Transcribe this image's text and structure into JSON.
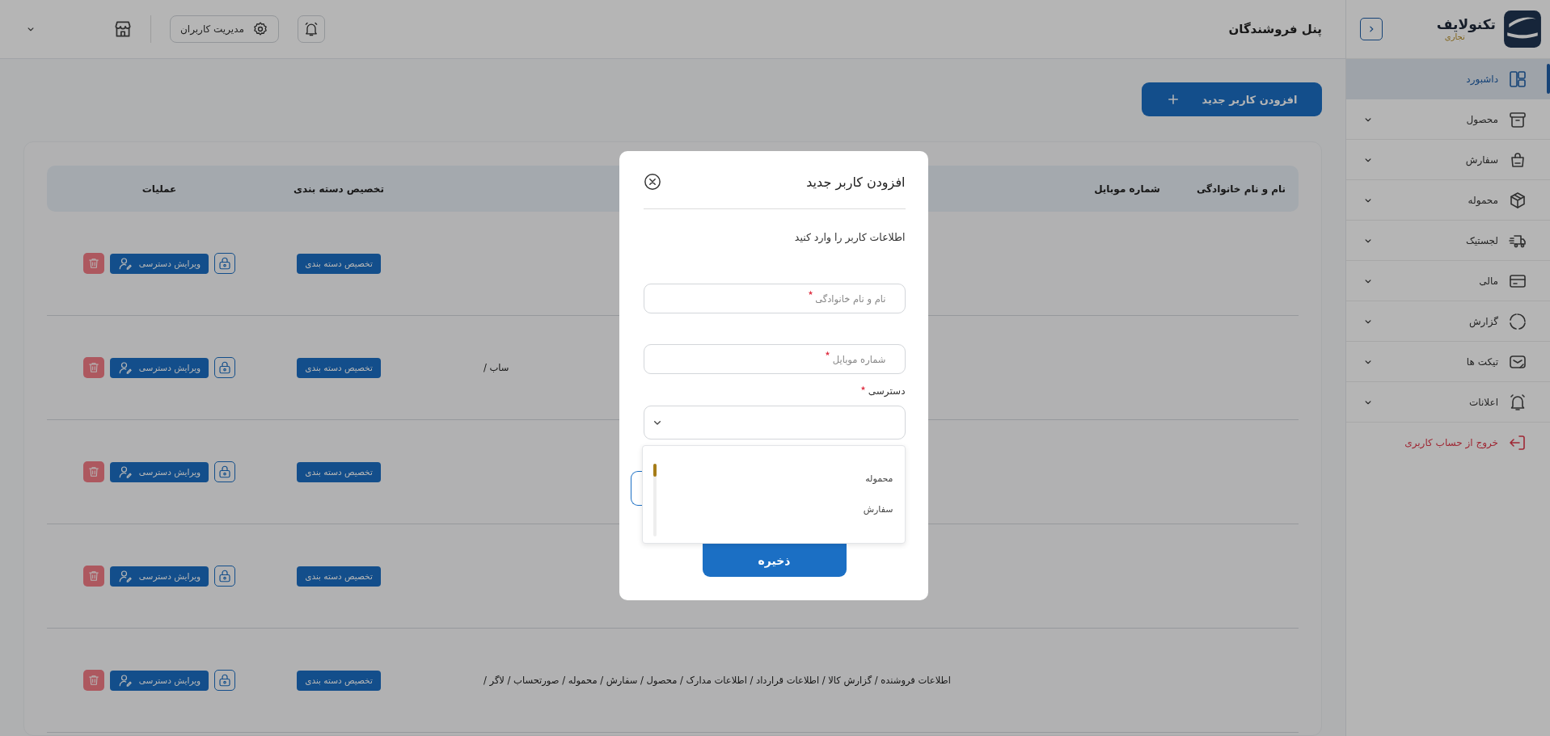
{
  "sidebar": {
    "brand": {
      "name": "تکنولایف",
      "tagline": "تجاری"
    },
    "items": [
      {
        "label": "داشبورد",
        "kind": "dashboard",
        "selected": true,
        "expandable": false
      },
      {
        "label": "محصول",
        "kind": "archive",
        "selected": false,
        "expandable": true
      },
      {
        "label": "سفارش",
        "kind": "bag",
        "selected": false,
        "expandable": true
      },
      {
        "label": "محموله",
        "kind": "package",
        "selected": false,
        "expandable": true
      },
      {
        "label": "لجستیک",
        "kind": "truck",
        "selected": false,
        "expandable": true
      },
      {
        "label": "مالی",
        "kind": "card",
        "selected": false,
        "expandable": true
      },
      {
        "label": "گزارش",
        "kind": "circle",
        "selected": false,
        "expandable": true
      },
      {
        "label": "تیکت ها",
        "kind": "ticket",
        "selected": false,
        "expandable": true
      },
      {
        "label": "اعلانات",
        "kind": "bell",
        "selected": false,
        "expandable": true
      }
    ],
    "logout": "خروج از حساب کاربری"
  },
  "topbar": {
    "title": "پنل فروشندگان",
    "user_management": "مدیریت کاربران"
  },
  "add_button": "افزودن کاربر جدید",
  "table": {
    "columns": [
      "نام و نام خانوادگی",
      "شماره موبایل",
      "تخصیص دسته بندی",
      "عملیات"
    ],
    "rows": [
      {
        "access": "",
        "assign": "تخصیص دسته بندی",
        "edit": "ویرایش دسترسی"
      },
      {
        "access": "ساب /",
        "assign": "تخصیص دسته بندی",
        "edit": "ویرایش دسترسی"
      },
      {
        "access": "",
        "assign": "تخصیص دسته بندی",
        "edit": "ویرایش دسترسی"
      },
      {
        "access": "",
        "assign": "تخصیص دسته بندی",
        "edit": "ویرایش دسترسی"
      },
      {
        "access": "اطلاعات فروشنده / گزارش کالا / اطلاعات قرارداد / اطلاعات مدارک / محصول / سفارش / محموله / صورتحساب / لاگر /",
        "assign": "تخصیص دسته بندی",
        "edit": "ویرایش دسترسی"
      }
    ]
  },
  "modal": {
    "title": "افزودن کاربر جدید",
    "subtitle": "اطلاعات کاربر را وارد کنید",
    "fields": [
      {
        "placeholder": "نام و نام خانوادگی",
        "required": true
      },
      {
        "placeholder": "شماره موبایل",
        "required": true
      }
    ],
    "access": {
      "label": "دسترسی",
      "required": true,
      "options": [
        {
          "label": "محموله",
          "selected": false
        },
        {
          "label": "سفارش",
          "selected": false
        }
      ]
    },
    "save": "ذخیره"
  }
}
